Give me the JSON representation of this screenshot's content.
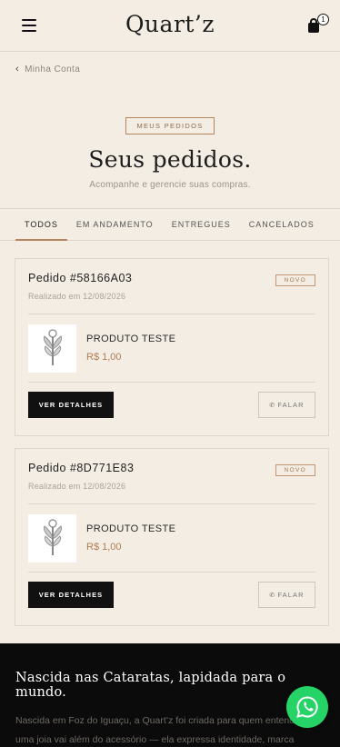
{
  "header": {
    "logo": "Quart’z",
    "cart_count": "1"
  },
  "back_link": "Minha Conta",
  "hero": {
    "badge": "MEUS PEDIDOS",
    "title": "Seus pedidos.",
    "subtitle": "Acompanhe e gerencie suas compras."
  },
  "tabs": [
    {
      "label": "TODOS",
      "active": true
    },
    {
      "label": "EM ANDAMENTO",
      "active": false
    },
    {
      "label": "ENTREGUES",
      "active": false
    },
    {
      "label": "CANCELADOS",
      "active": false
    }
  ],
  "orders": [
    {
      "number": "Pedido #58166A03",
      "status": "NOVO",
      "date": "Realizado em 12/08/2026",
      "item_name": "PRODUTO TESTE",
      "item_price": "R$ 1,00",
      "details_label": "VER DETALHES",
      "talk_label": "FALAR"
    },
    {
      "number": "Pedido #8D771E83",
      "status": "NOVO",
      "date": "Realizado em 12/08/2026",
      "item_name": "PRODUTO TESTE",
      "item_price": "R$ 1,00",
      "details_label": "VER DETALHES",
      "talk_label": "FALAR"
    }
  ],
  "footer": {
    "heading": "Nascida nas Cataratas, lapidada para o mundo.",
    "text": "Nascida em Foz do Iguaçu, a Quart’z foi criada para quem entende que uma joia vai além do acessório — ela expressa identidade, marca momentos e carrega significado. Desde"
  },
  "colors": {
    "accent": "#b58760",
    "background": "#f3ede3",
    "dark": "#111111",
    "whatsapp": "#25d366"
  },
  "icons": [
    "menu-icon",
    "cart-icon",
    "chevron-left-icon",
    "whatsapp-icon"
  ]
}
